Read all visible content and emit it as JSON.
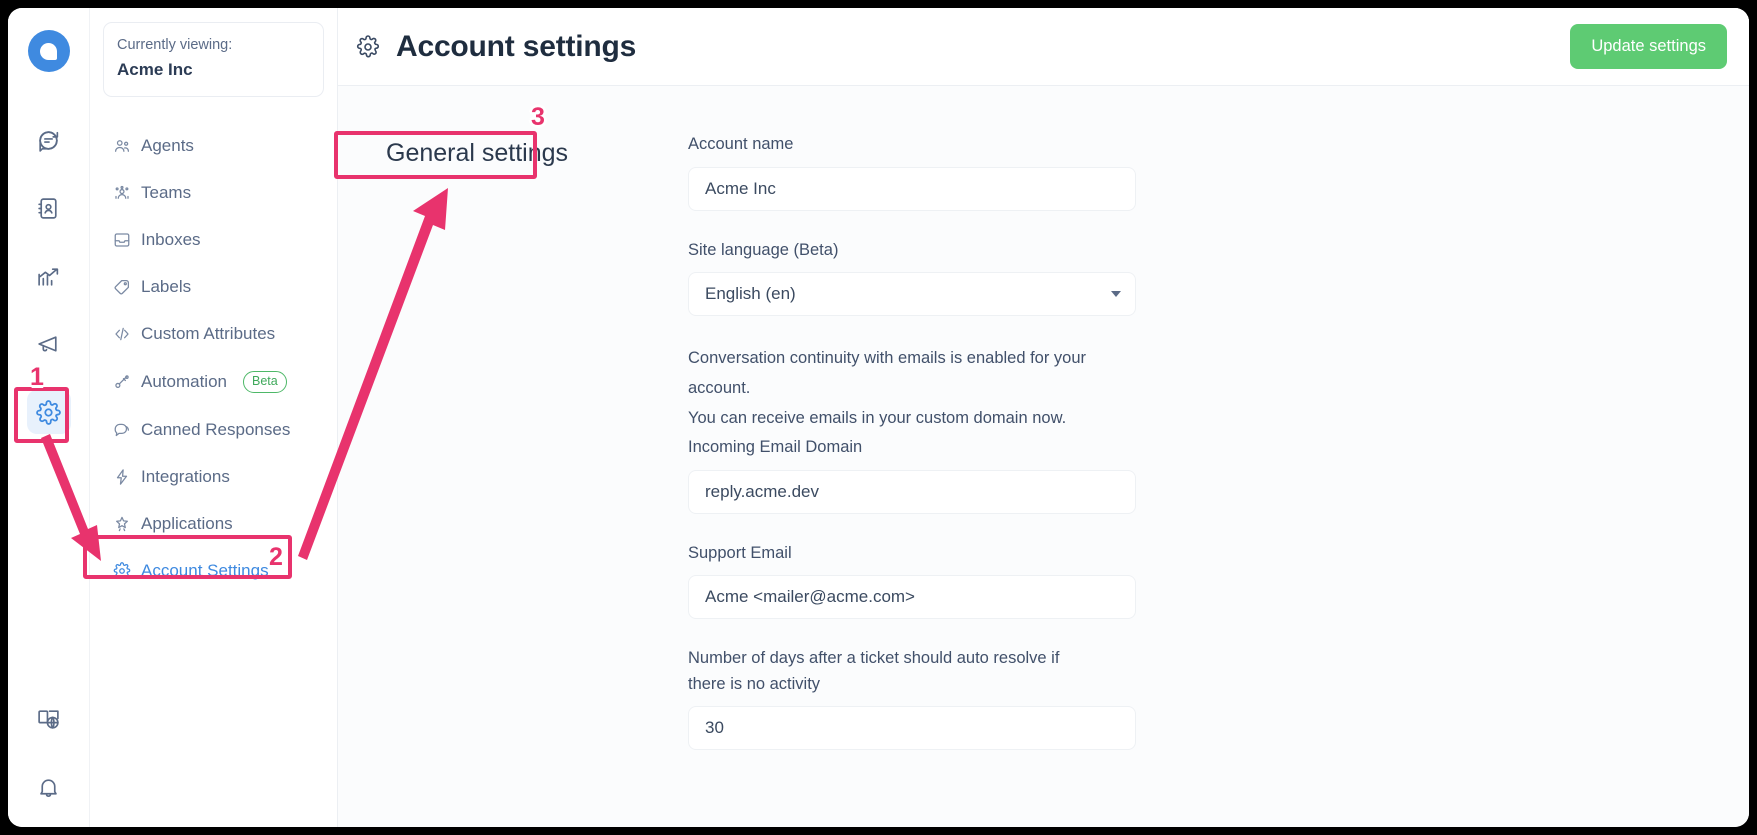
{
  "window": {
    "background": "#000000",
    "app_background": "#ffffff"
  },
  "colors": {
    "accent_blue": "#3f8ae0",
    "update_button_green": "#5ecb73",
    "annotation_pink": "#e8336d",
    "beta_green": "#4eb868",
    "text_dark": "#1f2d3f",
    "text_muted": "#5b6b87"
  },
  "rail": {
    "logo_name": "chatwoot-logo",
    "icons": [
      {
        "name": "conversations-icon",
        "active": false
      },
      {
        "name": "contacts-book-icon",
        "active": false
      },
      {
        "name": "reports-chart-icon",
        "active": false
      },
      {
        "name": "campaigns-megaphone-icon",
        "active": false
      },
      {
        "name": "settings-gear-icon",
        "active": true
      }
    ],
    "bottom_icons": [
      {
        "name": "help-docs-icon",
        "active": false
      },
      {
        "name": "notifications-bell-icon",
        "active": false
      }
    ]
  },
  "sidebar": {
    "account_card": {
      "currently_viewing_label": "Currently viewing:",
      "account_name": "Acme Inc"
    },
    "items": [
      {
        "label": "Agents",
        "icon": "agents-icon",
        "selected": false,
        "beta": false
      },
      {
        "label": "Teams",
        "icon": "teams-icon",
        "selected": false,
        "beta": false
      },
      {
        "label": "Inboxes",
        "icon": "inboxes-icon",
        "selected": false,
        "beta": false
      },
      {
        "label": "Labels",
        "icon": "labels-tag-icon",
        "selected": false,
        "beta": false
      },
      {
        "label": "Custom Attributes",
        "icon": "code-brackets-icon",
        "selected": false,
        "beta": false
      },
      {
        "label": "Automation",
        "icon": "automation-icon",
        "selected": false,
        "beta": true,
        "beta_label": "Beta"
      },
      {
        "label": "Canned Responses",
        "icon": "canned-responses-icon",
        "selected": false,
        "beta": false
      },
      {
        "label": "Integrations",
        "icon": "integrations-bolt-icon",
        "selected": false,
        "beta": false
      },
      {
        "label": "Applications",
        "icon": "applications-star-icon",
        "selected": false,
        "beta": false
      },
      {
        "label": "Account Settings",
        "icon": "account-settings-gear-icon",
        "selected": true,
        "beta": false
      }
    ]
  },
  "topbar": {
    "icon": "settings-gear-icon",
    "title": "Account settings",
    "update_button_label": "Update settings"
  },
  "content": {
    "section_title": "General settings",
    "fields": [
      {
        "type": "text",
        "label": "Account name",
        "value": "Acme Inc"
      },
      {
        "type": "select",
        "label": "Site language (Beta)",
        "value": "English (en)"
      }
    ],
    "note_lines": [
      "Conversation continuity with emails is enabled for your",
      "account.",
      "You can receive emails in your custom domain now."
    ],
    "incoming_email_domain": {
      "label": "Incoming Email Domain",
      "value": "reply.acme.dev"
    },
    "support_email": {
      "label": "Support Email",
      "value": "Acme <mailer@acme.com>"
    },
    "auto_resolve": {
      "label_line1": "Number of days after a ticket should auto resolve if",
      "label_line2": "there is no activity",
      "value": "30"
    }
  },
  "annotations": {
    "step1": "1",
    "step2": "2",
    "step3": "3"
  }
}
